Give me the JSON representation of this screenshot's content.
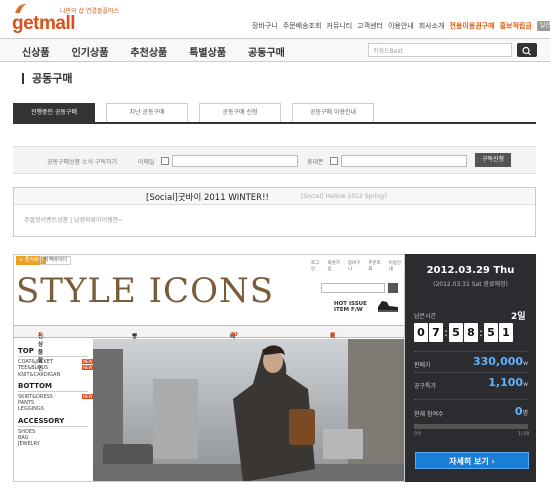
{
  "logo": {
    "tagline": "나만의 샵 연결몰플러스",
    "text": "getmall"
  },
  "topnav": {
    "links": [
      "장바구니",
      "주문배송조회",
      "커뮤니티",
      "고객센터",
      "이용안내",
      "회사소개"
    ],
    "highlight": [
      "전용이용권구매",
      "홍보적립금"
    ],
    "mini": [
      "일산바로"
    ]
  },
  "mainnav": {
    "items": [
      "신상품",
      "인기상품",
      "추천상품",
      "특별상품",
      "공동구매"
    ],
    "search_placeholder": "키워드Best"
  },
  "page_title": "공동구매",
  "tabs": [
    "진행중인 공동구매",
    "지난 공동구매",
    "공동구매 신청",
    "공동구매 이용안내"
  ],
  "subscribe": {
    "label": "공동구매상품 소식 구독하기",
    "email": "이메일",
    "phone": "휴대폰",
    "button": "구독신청"
  },
  "social": {
    "current": "[Social]굿바이 2011 WINTER!!",
    "next": "[Social] Hellow 2012 Spring?",
    "body": "주말핫이벤트상품 | 남성의류아이템만~"
  },
  "banner": {
    "menu": "+ 즐겨찾기",
    "fav": "지역바이더",
    "minilinks": [
      "로그인",
      "회원가입",
      "장바구니",
      "주문조회",
      "이용안내"
    ],
    "title": "STYLE ICONS",
    "hot": [
      "HOT ISSUE",
      "ITEM F/W"
    ],
    "catbar": [
      {
        "label": "신상품할인",
        "num": "5"
      },
      {
        "label": "당일배송상품"
      },
      {
        "label": "베스트아이템",
        "num": "30"
      },
      {
        "label": "이벤트&혜택"
      }
    ],
    "categories": [
      {
        "head": "TOP",
        "items": [
          "COAT&JACKET",
          "TEE&BLOUS",
          "KNIT&CARDIGAN"
        ],
        "new": [
          0,
          1
        ]
      },
      {
        "head": "BOTTOM",
        "items": [
          "SKIRT&DRESS",
          "PANTS",
          "LEGGINGS"
        ],
        "new": [
          0
        ]
      },
      {
        "head": "ACCESSORY",
        "items": [
          "SHOES",
          "BAG",
          "JEWELRY"
        ],
        "new": []
      }
    ]
  },
  "side": {
    "date": "2012.03.29 Thu",
    "sub": "(2012.03.31 Sat 완료예정)",
    "remain_label": "남은시간",
    "remain_days": "2일",
    "digits": [
      "0",
      "7",
      "5",
      "8",
      "5",
      "1"
    ],
    "price_label": "판매가",
    "price": "330,000",
    "price_unit": "w",
    "group_label": "공구특가",
    "group_price": "1,100",
    "group_unit": "w",
    "join_label": "현재 참여수",
    "join": "0",
    "join_unit": "명",
    "scale_min": "0명",
    "scale_max": "1/3명",
    "detail": "자세히 보기"
  },
  "colors": {
    "accent": "#d9501c",
    "side_bg": "#2b2c30",
    "button_blue": "#1b7fd8"
  }
}
